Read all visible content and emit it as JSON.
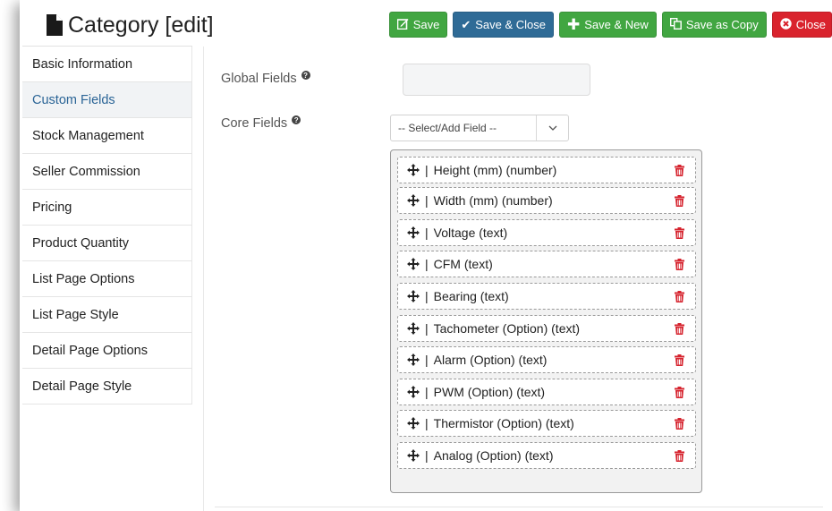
{
  "header": {
    "title": "Category [edit]",
    "buttons": {
      "save": "Save",
      "save_close": "Save & Close",
      "save_new": "Save & New",
      "save_copy": "Save as Copy",
      "close": "Close"
    }
  },
  "sidebar": {
    "items": [
      {
        "label": "Basic Information"
      },
      {
        "label": "Custom Fields",
        "active": true
      },
      {
        "label": "Stock Management"
      },
      {
        "label": "Seller Commission"
      },
      {
        "label": "Pricing"
      },
      {
        "label": "Product Quantity"
      },
      {
        "label": "List Page Options"
      },
      {
        "label": "List Page Style"
      },
      {
        "label": "Detail Page Options"
      },
      {
        "label": "Detail Page Style"
      }
    ]
  },
  "form": {
    "global_fields_label": "Global Fields",
    "global_fields_value": "",
    "core_fields_label": "Core Fields",
    "core_fields_select": "-- Select/Add Field --"
  },
  "fields": [
    "Height (mm) (number)",
    "Width (mm) (number)",
    "Voltage (text)",
    "CFM (text)",
    "Bearing (text)",
    "Tachometer (Option) (text)",
    "Alarm (Option) (text)",
    "PWM (Option) (text)",
    "Thermistor (Option) (text)",
    "Analog (Option) (text)"
  ],
  "colors": {
    "green": "#41a641",
    "blue": "#2f6b96",
    "red": "#d9232d",
    "trash": "#d6232e",
    "active_link": "#2a6496"
  },
  "icons": {
    "title": "document-icon",
    "save": "edit-icon",
    "save_close": "check-icon",
    "save_new": "plus-icon",
    "save_copy": "copy-icon",
    "close": "times-circle-icon",
    "help": "question-circle-icon",
    "drag": "move-icon",
    "delete": "trash-icon"
  }
}
